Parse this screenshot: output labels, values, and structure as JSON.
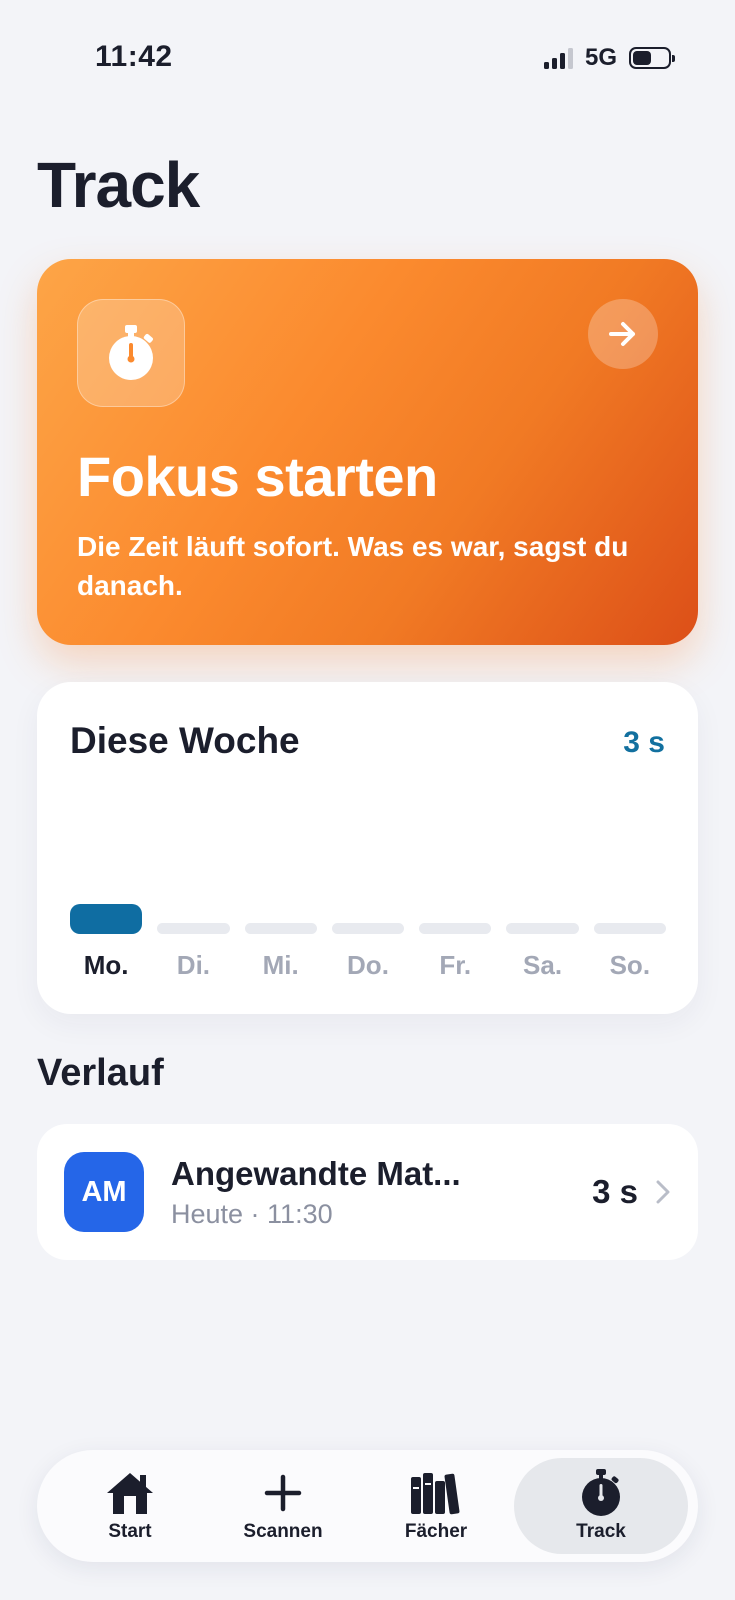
{
  "status": {
    "time": "11:42",
    "network": "5G"
  },
  "page": {
    "title": "Track"
  },
  "focus": {
    "title": "Fokus starten",
    "subtitle": "Die Zeit läuft sofort. Was es war, sagst du danach.",
    "icon": "stopwatch-icon",
    "action_icon": "arrow-right-icon"
  },
  "week": {
    "title": "Diese Woche",
    "total": "3 s",
    "days": [
      {
        "label": "Mo.",
        "active": true
      },
      {
        "label": "Di.",
        "active": false
      },
      {
        "label": "Mi.",
        "active": false
      },
      {
        "label": "Do.",
        "active": false
      },
      {
        "label": "Fr.",
        "active": false
      },
      {
        "label": "Sa.",
        "active": false
      },
      {
        "label": "So.",
        "active": false
      }
    ]
  },
  "history": {
    "title": "Verlauf",
    "items": [
      {
        "initials": "AM",
        "title": "Angewandte Mat...",
        "subtitle": "Heute · 11:30",
        "duration": "3 s"
      }
    ]
  },
  "tabs": [
    {
      "label": "Start",
      "icon": "home-icon",
      "active": false
    },
    {
      "label": "Scannen",
      "icon": "plus-icon",
      "active": false
    },
    {
      "label": "Fächer",
      "icon": "books-icon",
      "active": false
    },
    {
      "label": "Track",
      "icon": "stopwatch-icon",
      "active": true
    }
  ],
  "colors": {
    "accent": "#0f6da2",
    "focus_orange": "#fb8a2e",
    "avatar_blue": "#2566e8"
  }
}
